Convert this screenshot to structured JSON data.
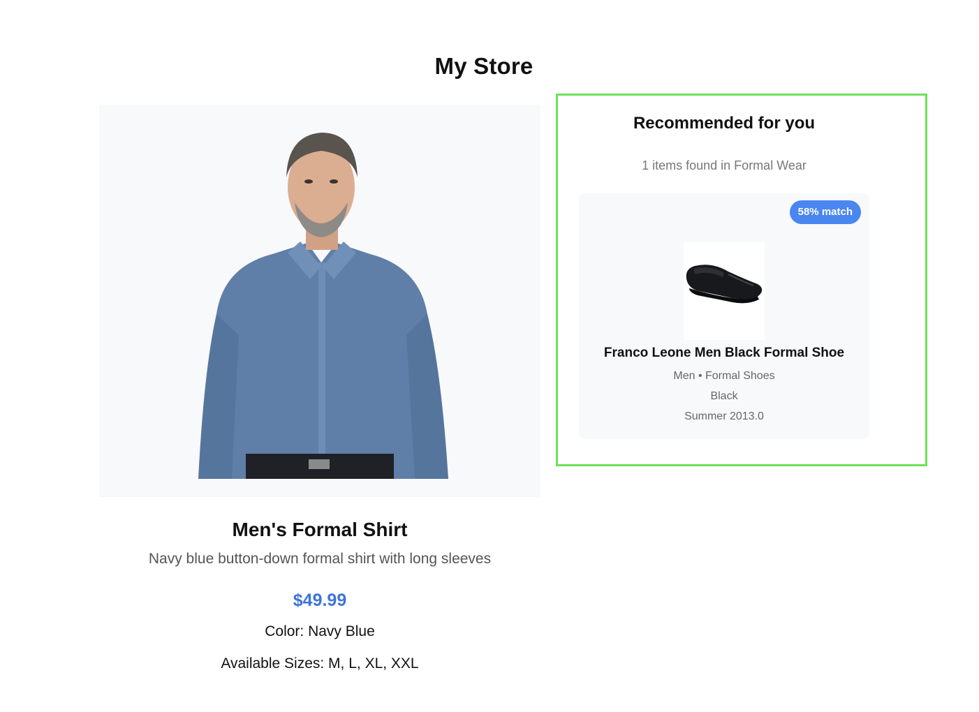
{
  "header": {
    "title": "My Store"
  },
  "product": {
    "name": "Men's Formal Shirt",
    "description": "Navy blue button-down formal shirt with long sleeves",
    "price": "$49.99",
    "color_text": "Color: Navy Blue",
    "sizes_text": "Available Sizes: M, L, XL, XXL"
  },
  "recommendations": {
    "title": "Recommended for you",
    "count_text": "1 items found in Formal Wear",
    "items": [
      {
        "match_badge": "58% match",
        "name": "Franco Leone Men Black Formal Shoe",
        "category": "Men • Formal Shoes",
        "color": "Black",
        "season": "Summer 2013.0"
      }
    ]
  },
  "colors": {
    "price": "#3f74d8",
    "badge": "#4a86f0",
    "panel_border": "#6fe05a"
  }
}
